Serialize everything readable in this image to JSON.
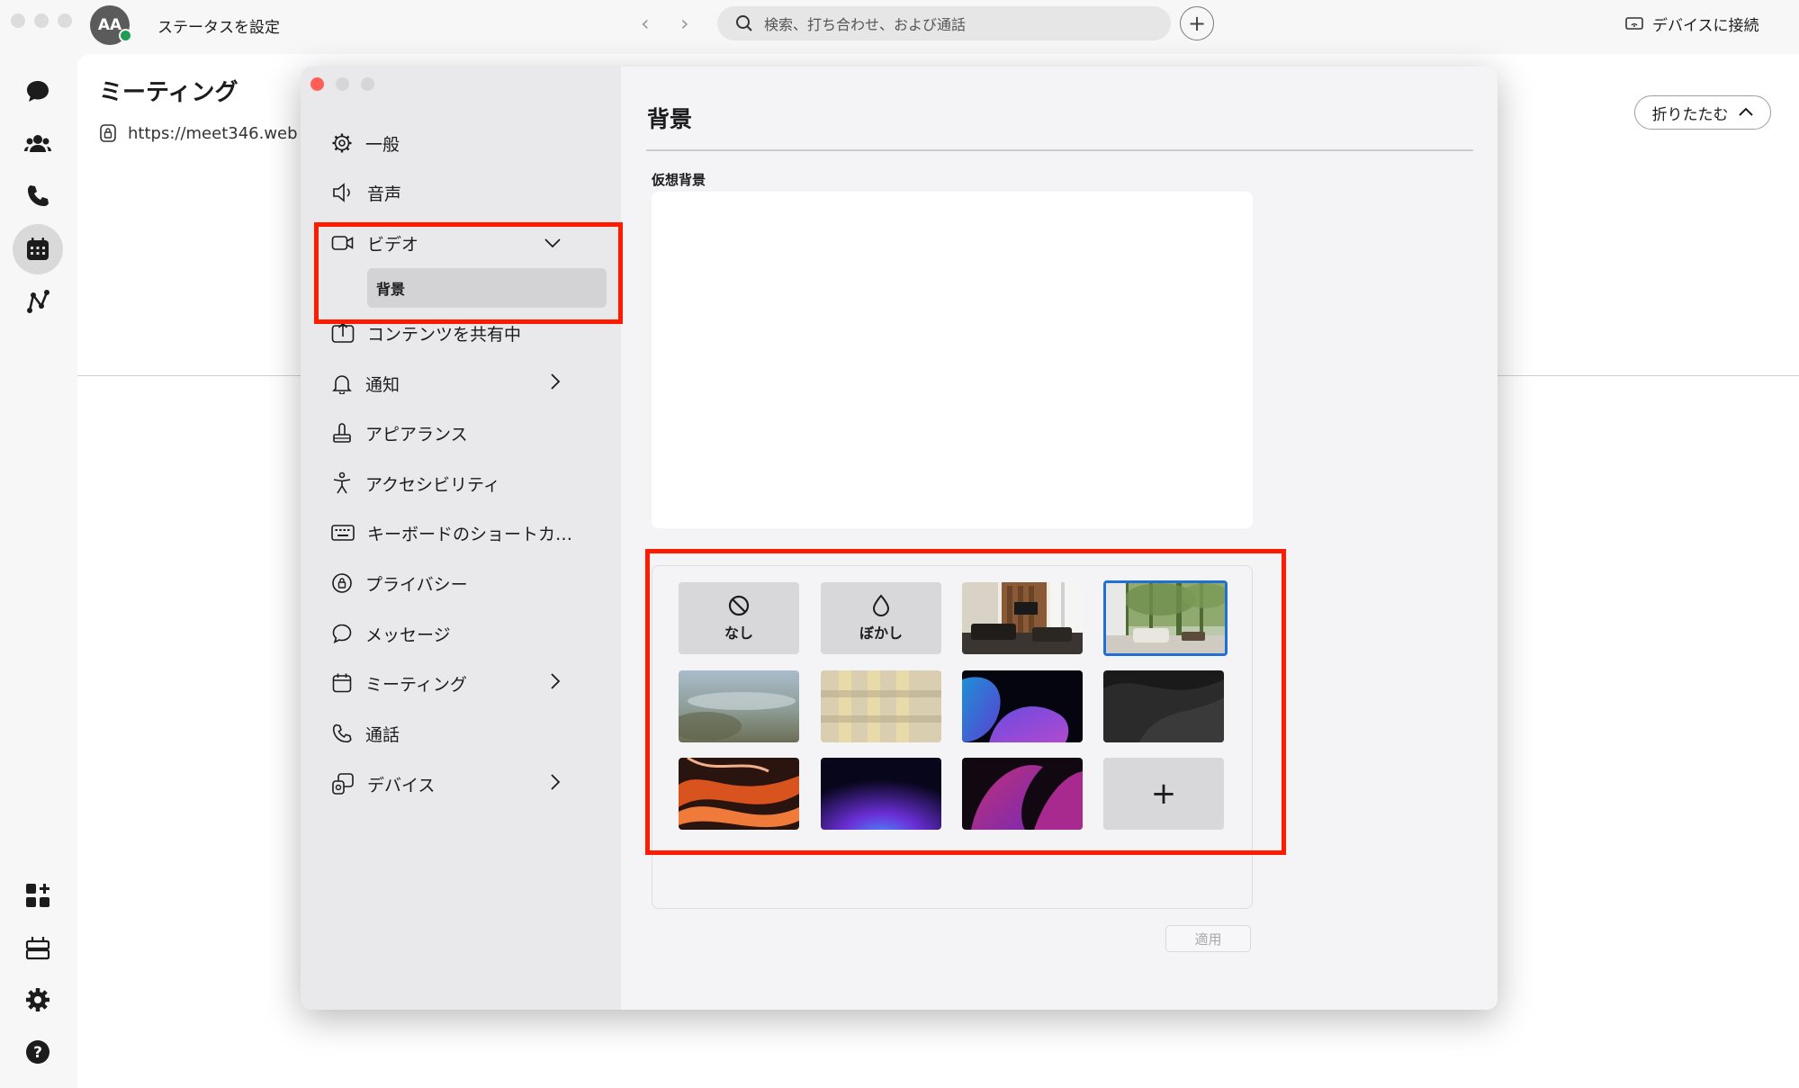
{
  "topbar": {
    "avatar_initials": "AA",
    "status_label": "ステータスを設定",
    "back_arrow": "‹",
    "forward_arrow": "›",
    "search_placeholder": "検索、打ち合わせ、および通話",
    "plus_label": "+",
    "connect_label": "デバイスに接続"
  },
  "main": {
    "title": "ミーティング",
    "url": "https://meet346.web",
    "collapse_label": "折りたたむ",
    "collapse_chevron": "⌃"
  },
  "rail": {
    "top_icons": [
      "chat-icon",
      "team-icon",
      "phone-icon",
      "calendar-icon",
      "analytics-icon"
    ],
    "bottom_icons": [
      "apps-add-icon",
      "templates-icon",
      "settings-gear-icon",
      "help-icon"
    ],
    "active": "calendar-icon"
  },
  "settings": {
    "sidebar": {
      "general": "一般",
      "audio": "音声",
      "video": "ビデオ",
      "video_sub_background": "背景",
      "content_share": "コンテンツを共有中",
      "notifications": "通知",
      "appearance": "アピアランス",
      "accessibility": "アクセシビリティ",
      "keyboard_shortcuts": "キーボードのショートカ…",
      "privacy": "プライバシー",
      "messages": "メッセージ",
      "meetings": "ミーティング",
      "calls": "通話",
      "devices": "デバイス",
      "chevron_right": "›",
      "chevron_down": "⌄"
    },
    "content": {
      "title": "背景",
      "virtual_background_label": "仮想背景",
      "none_label": "なし",
      "blur_label": "ぼかし",
      "add_label": "+",
      "apply_label": "適用"
    }
  },
  "colors": {
    "highlight_red": "#ff1a00",
    "selected_blue": "#1f6fd6",
    "presence_green": "#1f9d55"
  }
}
